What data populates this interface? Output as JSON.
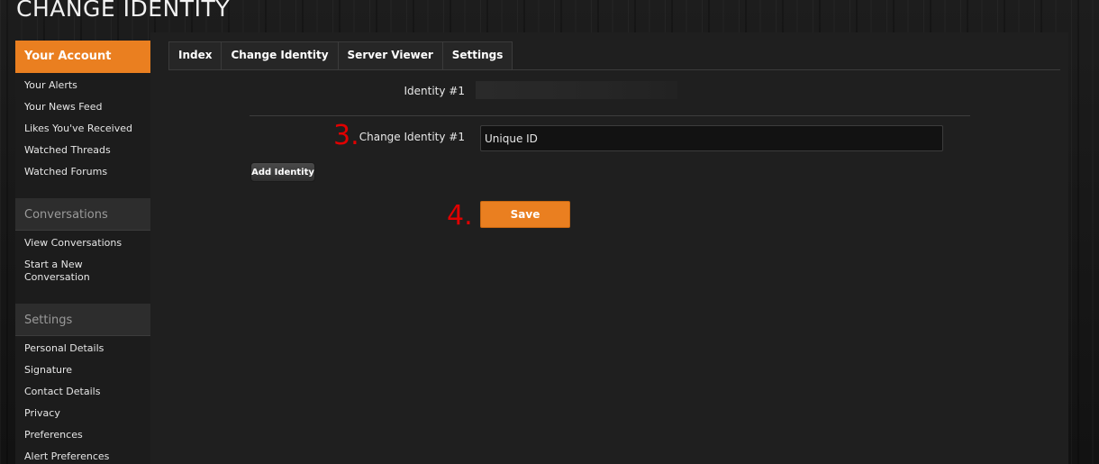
{
  "page": {
    "title": "CHANGE IDENTITY"
  },
  "sidebar": {
    "account": {
      "header": "Your Account",
      "items": [
        "Your Alerts",
        "Your News Feed",
        "Likes You've Received",
        "Watched Threads",
        "Watched Forums"
      ]
    },
    "conversations": {
      "header": "Conversations",
      "items": [
        "View Conversations",
        "Start a New Conversation"
      ]
    },
    "settings": {
      "header": "Settings",
      "items": [
        "Personal Details",
        "Signature",
        "Contact Details",
        "Privacy",
        "Preferences",
        "Alert Preferences"
      ]
    }
  },
  "tabs": [
    "Index",
    "Change Identity",
    "Server Viewer",
    "Settings"
  ],
  "form": {
    "identity_label": "Identity #1",
    "change_label": "Change Identity #1",
    "change_value": "Unique ID",
    "add_button": "Add Identity",
    "save_button": "Save"
  },
  "annotations": {
    "step3": "3.",
    "step4": "4."
  },
  "colors": {
    "accent": "#ea7f20",
    "annotation": "#e00000"
  }
}
